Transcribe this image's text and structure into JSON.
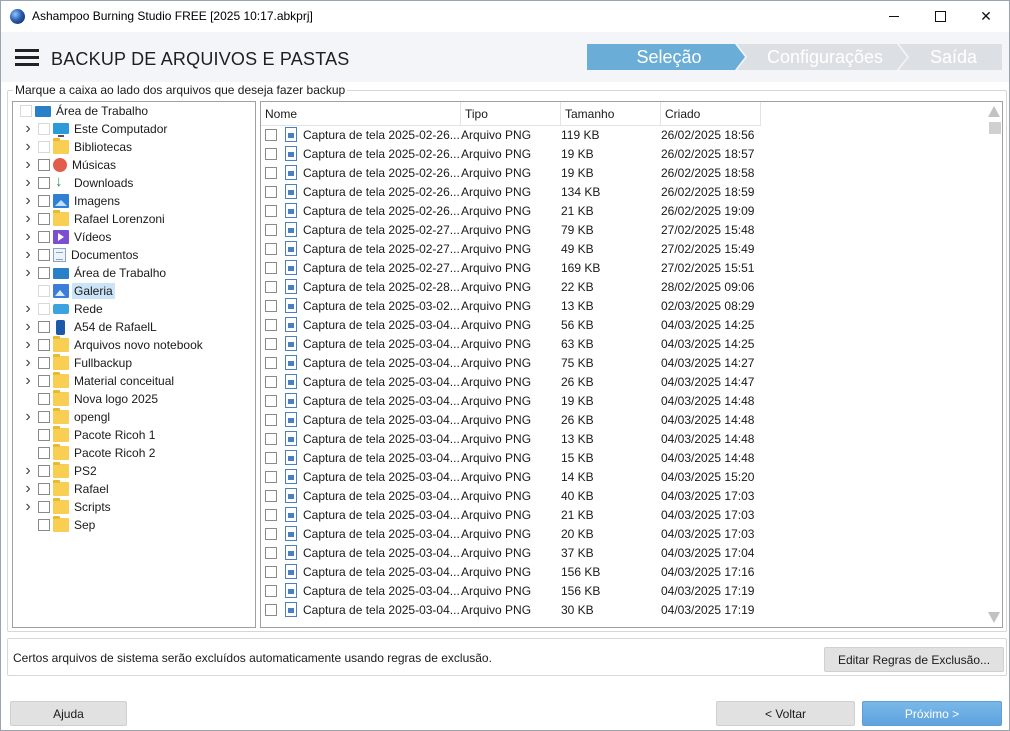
{
  "window": {
    "title": "Ashampoo Burning Studio FREE [2025 10:17.abkprj]"
  },
  "header": {
    "title": "BACKUP DE ARQUIVOS E PASTAS",
    "steps": [
      "Seleção",
      "Configurações",
      "Saída"
    ],
    "active_step": 0
  },
  "instruction": "Marque a caixa ao lado dos arquivos que deseja fazer backup",
  "tree": {
    "root": "Área de Trabalho",
    "items": [
      {
        "label": "Este Computador",
        "icon": "computer-icon",
        "expandable": true
      },
      {
        "label": "Bibliotecas",
        "icon": "folder-icon",
        "expandable": true
      },
      {
        "label": "Músicas",
        "icon": "music-icon",
        "expandable": true
      },
      {
        "label": "Downloads",
        "icon": "download-icon",
        "expandable": true
      },
      {
        "label": "Imagens",
        "icon": "image-icon",
        "expandable": true
      },
      {
        "label": "Rafael Lorenzoni",
        "icon": "folder-icon",
        "expandable": true
      },
      {
        "label": "Vídeos",
        "icon": "video-icon",
        "expandable": true
      },
      {
        "label": "Documentos",
        "icon": "document-icon",
        "expandable": true
      },
      {
        "label": "Área de Trabalho",
        "icon": "desktop-icon",
        "expandable": true
      },
      {
        "label": "Galeria",
        "icon": "gallery-icon",
        "expandable": false,
        "selected": true
      },
      {
        "label": "Rede",
        "icon": "network-icon",
        "expandable": true
      },
      {
        "label": "A54 de RafaelL",
        "icon": "phone-icon",
        "expandable": true
      },
      {
        "label": "Arquivos novo notebook",
        "icon": "folder-icon",
        "expandable": true
      },
      {
        "label": "Fullbackup",
        "icon": "folder-icon",
        "expandable": true
      },
      {
        "label": "Material conceitual",
        "icon": "folder-icon",
        "expandable": true
      },
      {
        "label": "Nova logo 2025",
        "icon": "folder-icon",
        "expandable": false
      },
      {
        "label": "opengl",
        "icon": "folder-icon",
        "expandable": true
      },
      {
        "label": "Pacote Ricoh 1",
        "icon": "folder-icon",
        "expandable": false
      },
      {
        "label": "Pacote Ricoh 2",
        "icon": "folder-icon",
        "expandable": false
      },
      {
        "label": "PS2",
        "icon": "folder-icon",
        "expandable": true
      },
      {
        "label": "Rafael",
        "icon": "folder-icon",
        "expandable": true
      },
      {
        "label": "Scripts",
        "icon": "folder-icon",
        "expandable": true
      },
      {
        "label": "Sep",
        "icon": "folder-icon",
        "expandable": false
      }
    ]
  },
  "filelist": {
    "columns": [
      "Nome",
      "Tipo",
      "Tamanho",
      "Criado"
    ],
    "rows": [
      [
        "Captura de tela 2025-02-26...",
        "Arquivo PNG",
        "119 KB",
        "26/02/2025 18:56"
      ],
      [
        "Captura de tela 2025-02-26...",
        "Arquivo PNG",
        "19 KB",
        "26/02/2025 18:57"
      ],
      [
        "Captura de tela 2025-02-26...",
        "Arquivo PNG",
        "19 KB",
        "26/02/2025 18:58"
      ],
      [
        "Captura de tela 2025-02-26...",
        "Arquivo PNG",
        "134 KB",
        "26/02/2025 18:59"
      ],
      [
        "Captura de tela 2025-02-26...",
        "Arquivo PNG",
        "21 KB",
        "26/02/2025 19:09"
      ],
      [
        "Captura de tela 2025-02-27...",
        "Arquivo PNG",
        "79 KB",
        "27/02/2025 15:48"
      ],
      [
        "Captura de tela 2025-02-27...",
        "Arquivo PNG",
        "49 KB",
        "27/02/2025 15:49"
      ],
      [
        "Captura de tela 2025-02-27...",
        "Arquivo PNG",
        "169 KB",
        "27/02/2025 15:51"
      ],
      [
        "Captura de tela 2025-02-28...",
        "Arquivo PNG",
        "22 KB",
        "28/02/2025 09:06"
      ],
      [
        "Captura de tela 2025-03-02...",
        "Arquivo PNG",
        "13 KB",
        "02/03/2025 08:29"
      ],
      [
        "Captura de tela 2025-03-04...",
        "Arquivo PNG",
        "56 KB",
        "04/03/2025 14:25"
      ],
      [
        "Captura de tela 2025-03-04...",
        "Arquivo PNG",
        "63 KB",
        "04/03/2025 14:25"
      ],
      [
        "Captura de tela 2025-03-04...",
        "Arquivo PNG",
        "75 KB",
        "04/03/2025 14:27"
      ],
      [
        "Captura de tela 2025-03-04...",
        "Arquivo PNG",
        "26 KB",
        "04/03/2025 14:47"
      ],
      [
        "Captura de tela 2025-03-04...",
        "Arquivo PNG",
        "19 KB",
        "04/03/2025 14:48"
      ],
      [
        "Captura de tela 2025-03-04...",
        "Arquivo PNG",
        "26 KB",
        "04/03/2025 14:48"
      ],
      [
        "Captura de tela 2025-03-04...",
        "Arquivo PNG",
        "13 KB",
        "04/03/2025 14:48"
      ],
      [
        "Captura de tela 2025-03-04...",
        "Arquivo PNG",
        "15 KB",
        "04/03/2025 14:48"
      ],
      [
        "Captura de tela 2025-03-04...",
        "Arquivo PNG",
        "14 KB",
        "04/03/2025 15:20"
      ],
      [
        "Captura de tela 2025-03-04...",
        "Arquivo PNG",
        "40 KB",
        "04/03/2025 17:03"
      ],
      [
        "Captura de tela 2025-03-04...",
        "Arquivo PNG",
        "21 KB",
        "04/03/2025 17:03"
      ],
      [
        "Captura de tela 2025-03-04...",
        "Arquivo PNG",
        "20 KB",
        "04/03/2025 17:03"
      ],
      [
        "Captura de tela 2025-03-04...",
        "Arquivo PNG",
        "37 KB",
        "04/03/2025 17:04"
      ],
      [
        "Captura de tela 2025-03-04...",
        "Arquivo PNG",
        "156 KB",
        "04/03/2025 17:16"
      ],
      [
        "Captura de tela 2025-03-04...",
        "Arquivo PNG",
        "156 KB",
        "04/03/2025 17:19"
      ],
      [
        "Captura de tela 2025-03-04...",
        "Arquivo PNG",
        "30 KB",
        "04/03/2025 17:19"
      ]
    ]
  },
  "info": {
    "text": "Certos arquivos de sistema serão excluídos automaticamente usando regras de exclusão.",
    "edit_button": "Editar Regras de  Exclusão..."
  },
  "footer": {
    "help": "Ajuda",
    "back": "< Voltar",
    "next": "Próximo >"
  },
  "colors": {
    "active_step": "#6aaed8",
    "inactive_step": "#dcdfe4",
    "next_button": "#6aaee4",
    "selection": "#cce4f7"
  }
}
